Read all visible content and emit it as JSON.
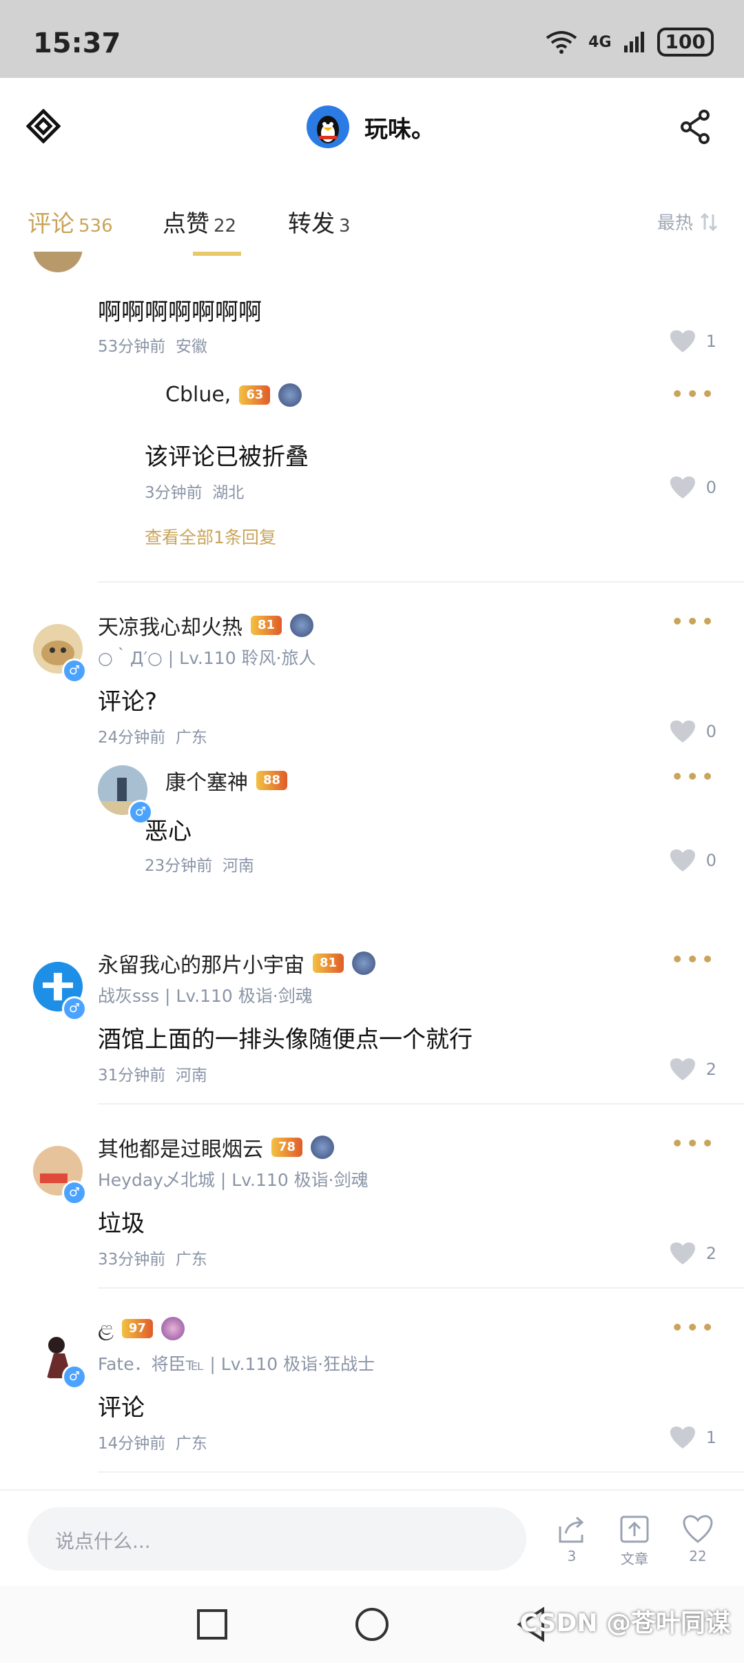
{
  "status": {
    "time": "15:37",
    "network": "4G",
    "battery": "100"
  },
  "header": {
    "title": "玩味。"
  },
  "tabs": [
    {
      "label": "评论",
      "count": "536"
    },
    {
      "label": "点赞",
      "count": "22"
    },
    {
      "label": "转发",
      "count": "3"
    }
  ],
  "sort": {
    "label": "最热"
  },
  "comments": [
    {
      "text": "啊啊啊啊啊啊啊",
      "time": "53分钟前",
      "region": "安徽",
      "likes": "1"
    },
    {
      "name": "Cblue,",
      "level": "63",
      "text": "该评论已被折叠",
      "time": "3分钟前",
      "region": "湖北",
      "likes": "0",
      "view_all": "查看全部1条回复"
    },
    {
      "name": "天凉我心却火热",
      "level": "81",
      "subtitle": "○｀Д′○ | Lv.110 聆风·旅人",
      "text": "评论?",
      "time": "24分钟前",
      "region": "广东",
      "likes": "0"
    },
    {
      "name": "康个塞神",
      "level": "88",
      "text": "恶心",
      "time": "23分钟前",
      "region": "河南",
      "likes": "0"
    },
    {
      "name": "永留我心的那片小宇宙",
      "level": "81",
      "subtitle": "战灰sss | Lv.110 极诣·剑魂",
      "text": "酒馆上面的一排头像随便点一个就行",
      "time": "31分钟前",
      "region": "河南",
      "likes": "2"
    },
    {
      "name": "其他都是过眼烟云",
      "level": "78",
      "subtitle": "Heyday乄北城 | Lv.110 极诣·剑魂",
      "text": "垃圾",
      "time": "33分钟前",
      "region": "广东",
      "likes": "2"
    },
    {
      "name": "ළ",
      "level": "97",
      "subtitle": "Fate．将臣℡ | Lv.110 极诣·狂战士",
      "text": "评论",
      "time": "14分钟前",
      "region": "广东",
      "likes": "1"
    }
  ],
  "bottom": {
    "placeholder": "说点什么...",
    "share_count": "3",
    "article_label": "文章",
    "like_count": "22"
  },
  "watermark": "CSDN @苍叶同谋"
}
